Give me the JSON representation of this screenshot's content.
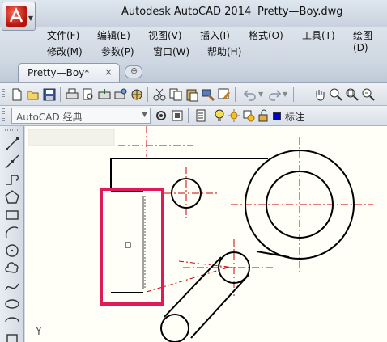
{
  "title": {
    "app": "Autodesk AutoCAD 2014",
    "file": "Pretty—Boy.dwg"
  },
  "menus": {
    "row1": [
      "文件(F)",
      "编辑(E)",
      "视图(V)",
      "插入(I)",
      "格式(O)",
      "工具(T)",
      "绘图(D)"
    ],
    "row2": [
      "修改(M)",
      "参数(P)",
      "窗口(W)",
      "帮助(H)"
    ]
  },
  "doc_tab": {
    "label": "Pretty—Boy*",
    "close": "×"
  },
  "workspace": {
    "value": "AutoCAD 经典"
  },
  "layer": {
    "name": "标注",
    "color": "#0000cc"
  },
  "canvas": {
    "axis_label": "Y"
  },
  "colors": {
    "highlight": "#e0195a",
    "centerline": "#cc0000",
    "geometry": "#000000",
    "background": "#fffff8"
  },
  "icons": {
    "standard": [
      "new-icon",
      "open-icon",
      "save-icon",
      "print-icon",
      "print-preview-icon",
      "publish-icon",
      "plot-3d-icon",
      "cut-icon",
      "copy-icon",
      "paste-icon",
      "match-properties-icon",
      "block-editor-icon",
      "undo-icon",
      "redo-icon",
      "pan-icon",
      "zoom-realtime-icon",
      "zoom-window-icon",
      "zoom-previous-icon"
    ],
    "draw": [
      "line-icon",
      "construction-line-icon",
      "polyline-icon",
      "polygon-icon",
      "rectangle-icon",
      "arc-icon",
      "circle-icon",
      "revision-cloud-icon",
      "spline-icon",
      "ellipse-icon",
      "ellipse-arc-icon",
      "insert-block-icon"
    ]
  }
}
